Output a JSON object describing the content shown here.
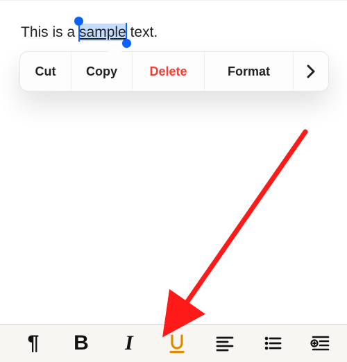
{
  "text": {
    "pre": "This is a ",
    "selected": "sample",
    "post": " text."
  },
  "menu": {
    "cut": "Cut",
    "copy": "Copy",
    "delete": "Delete",
    "format": "Format"
  },
  "toolbar": {
    "pilcrow": "¶",
    "bold": "B",
    "italic": "I"
  },
  "colors": {
    "accent": "#e08a00",
    "danger": "#ff3b30",
    "selection": "#0b62ff"
  }
}
